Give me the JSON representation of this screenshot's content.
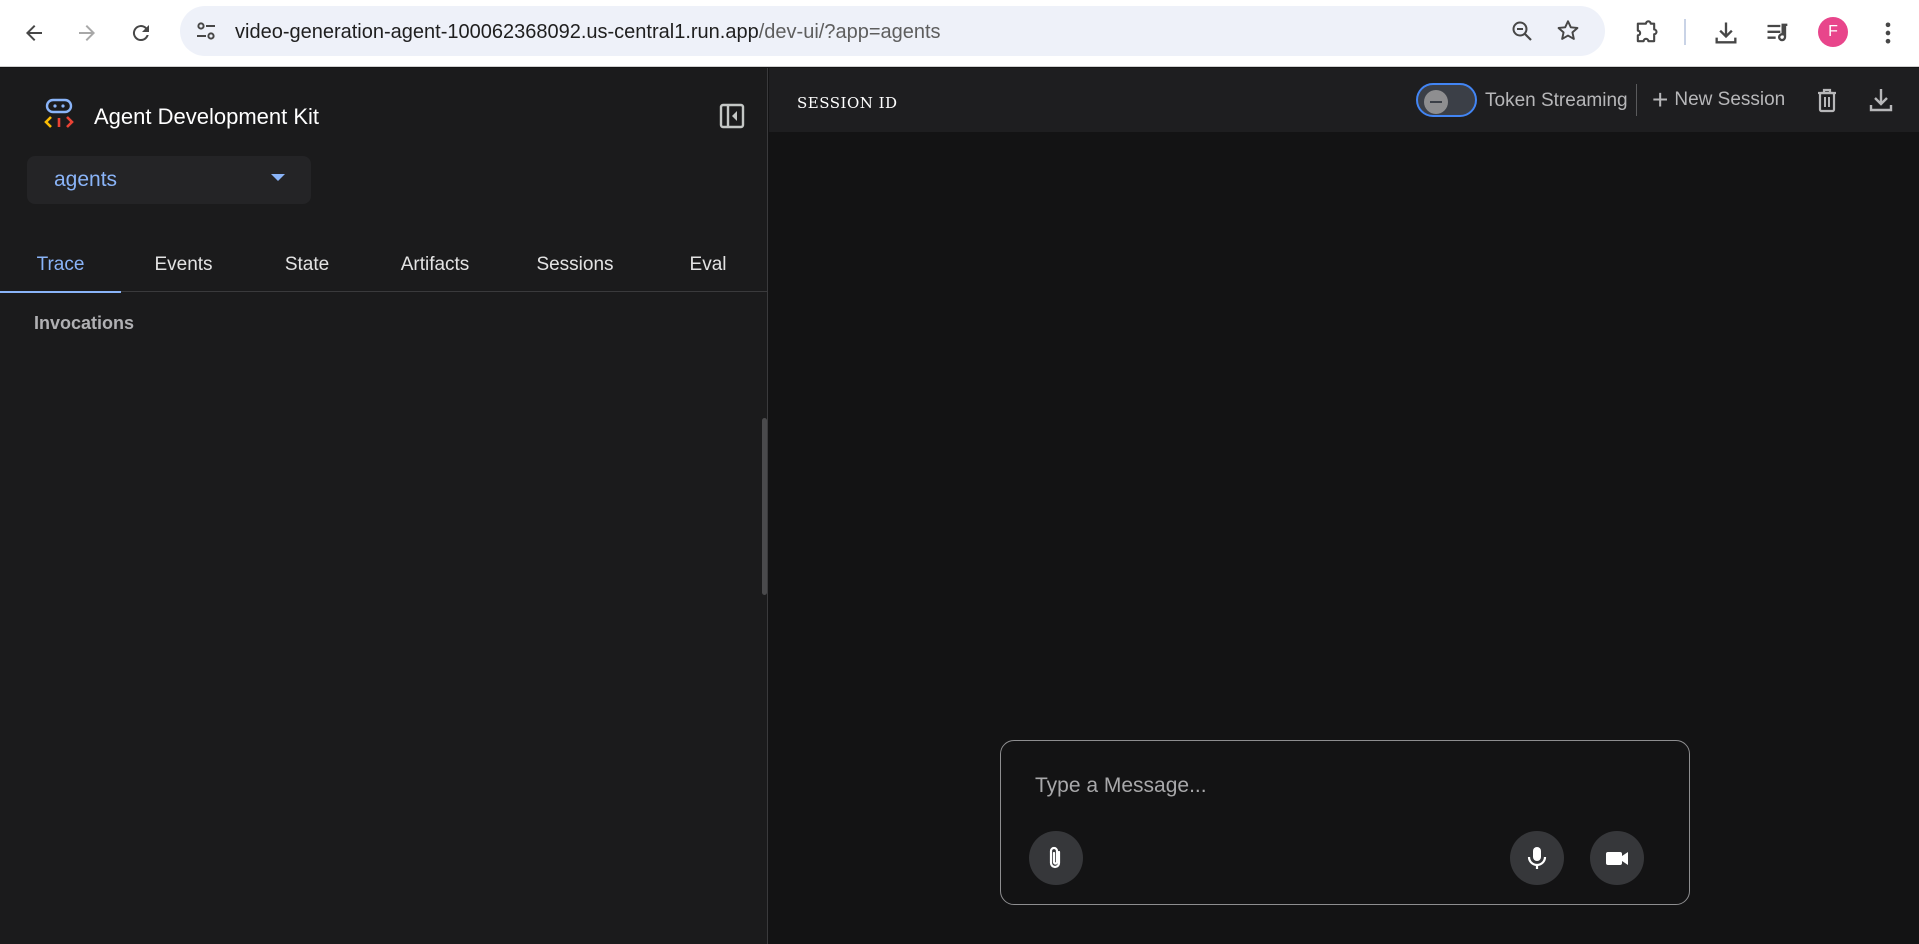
{
  "browser": {
    "url_main": "video-generation-agent-100062368092.us-central1.run.app",
    "url_path": "/dev-ui/?app=agents",
    "profile_initial": "F",
    "icons": [
      "back-icon",
      "forward-icon",
      "reload-icon",
      "site-settings-icon",
      "zoom-icon",
      "bookmark-star-icon",
      "extensions-icon",
      "downloads-icon",
      "media-controls-icon",
      "more-menu-icon"
    ]
  },
  "sidebar": {
    "app_title": "Agent Development Kit",
    "selected_agent": "agents",
    "tabs": [
      {
        "label": "Trace",
        "active": true
      },
      {
        "label": "Events",
        "active": false
      },
      {
        "label": "State",
        "active": false
      },
      {
        "label": "Artifacts",
        "active": false
      },
      {
        "label": "Sessions",
        "active": false
      },
      {
        "label": "Eval",
        "active": false
      }
    ],
    "section_title": "Invocations"
  },
  "toolbar": {
    "session_label": "SESSION ID",
    "token_streaming_label": "Token Streaming",
    "token_streaming_enabled": false,
    "new_session_label": "New Session"
  },
  "composer": {
    "placeholder": "Type a Message..."
  },
  "colors": {
    "accent": "#8ab4f8",
    "toggle_border": "#4285f4",
    "profile": "#e8458b",
    "panel_bg": "#1b1b1c",
    "main_bg": "#131314"
  }
}
